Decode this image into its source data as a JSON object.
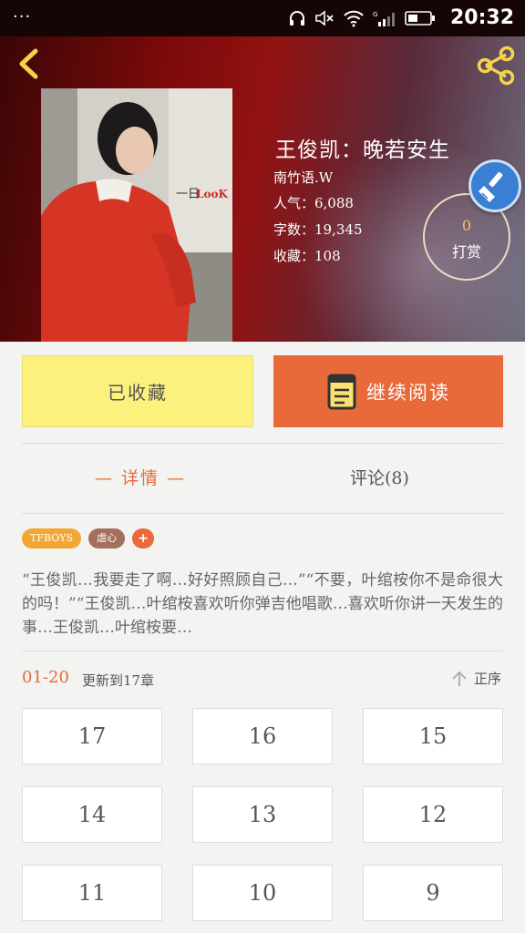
{
  "status_bar": {
    "time": "20:32",
    "menu_dots": "···"
  },
  "book": {
    "title": "王俊凯：晚若安生",
    "author": "南竹语.W",
    "popularity": "人气：6,088",
    "word_count": "字数：19,345",
    "favorites": "收藏：108"
  },
  "tip": {
    "count": "0",
    "label": "打赏"
  },
  "actions": {
    "collected_label": "已收藏",
    "continue_label": "继续阅读"
  },
  "tabs": {
    "detail": "— 详情 —",
    "comments": "评论(8)"
  },
  "tags": [
    "TFBOYS",
    "虐心",
    "+"
  ],
  "synopsis": "“王俊凯…我要走了啊…好好照顾自己…”“不要，叶绾桉你不是命很大的吗！”“王俊凯…叶绾桉喜欢听你弹吉他唱歌…喜欢听你讲一天发生的事…王俊凯…叶绾桉要…",
  "chapters": {
    "range": "01-20",
    "updated": "更新到17章",
    "sort_label": "正序",
    "items": [
      "17",
      "16",
      "15",
      "14",
      "13",
      "12",
      "11",
      "10",
      "9"
    ]
  },
  "colors": {
    "accent": "#e8693a",
    "collected_bg": "#fbf17c",
    "tag_tfboys": "#f3a632",
    "tag_nuexin": "#a2705d"
  }
}
